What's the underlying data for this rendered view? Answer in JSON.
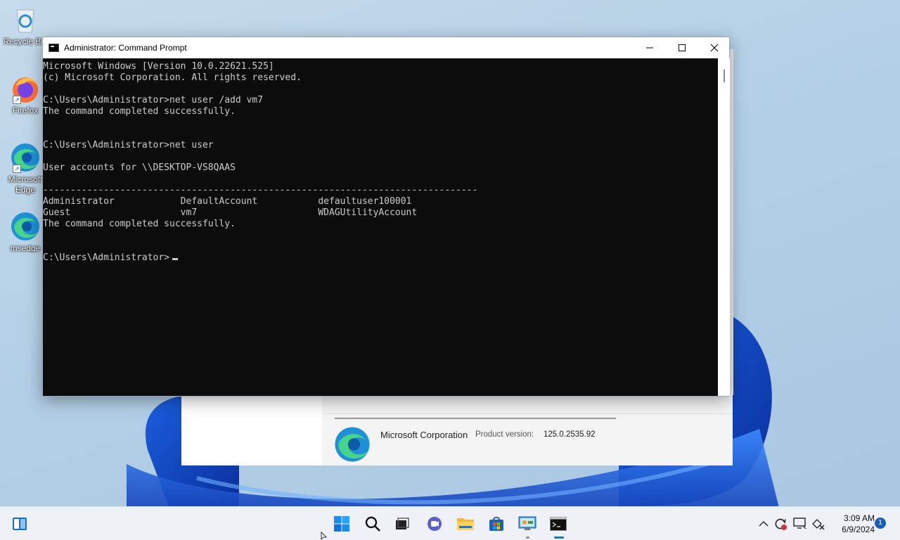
{
  "desktop": {
    "icons": [
      {
        "label": "Recycle Bin",
        "icon": "recycle-bin-icon"
      },
      {
        "label": "Firefox",
        "icon": "firefox-icon"
      },
      {
        "label": "Microsoft Edge",
        "icon": "edge-icon"
      },
      {
        "label": "msedge",
        "icon": "edge-icon"
      }
    ]
  },
  "background_dialog": {
    "company": "Microsoft Corporation",
    "product_version_label": "Product version:",
    "product_version": "125.0.2535.92"
  },
  "cmd_window": {
    "title": "Administrator: Command Prompt",
    "lines": [
      "Microsoft Windows [Version 10.0.22621.525]",
      "(c) Microsoft Corporation. All rights reserved.",
      "",
      "C:\\Users\\Administrator>net user /add vm7",
      "The command completed successfully.",
      "",
      "",
      "C:\\Users\\Administrator>net user",
      "",
      "User accounts for \\\\DESKTOP-VS8QAAS",
      "",
      "-------------------------------------------------------------------------------",
      "Administrator            DefaultAccount           defaultuser100001",
      "Guest                    vm7                      WDAGUtilityAccount",
      "The command completed successfully.",
      "",
      "",
      "C:\\Users\\Administrator>"
    ]
  },
  "taskbar": {
    "items": [
      {
        "name": "widgets",
        "icon": "widgets-icon"
      },
      {
        "name": "start",
        "icon": "windows-start-icon"
      },
      {
        "name": "search",
        "icon": "search-icon"
      },
      {
        "name": "task-view",
        "icon": "task-view-icon"
      },
      {
        "name": "chat",
        "icon": "chat-icon"
      },
      {
        "name": "file-explorer",
        "icon": "folder-icon"
      },
      {
        "name": "store",
        "icon": "store-icon"
      },
      {
        "name": "control-panel",
        "icon": "control-panel-icon"
      },
      {
        "name": "command-prompt",
        "icon": "terminal-icon"
      }
    ],
    "tray": {
      "time": "3:09 AM",
      "date": "6/9/2024",
      "notification_count": "1"
    }
  },
  "colors": {
    "console_bg": "#0c0c0c",
    "console_text": "#cccccc",
    "accent": "#1a73d9"
  }
}
